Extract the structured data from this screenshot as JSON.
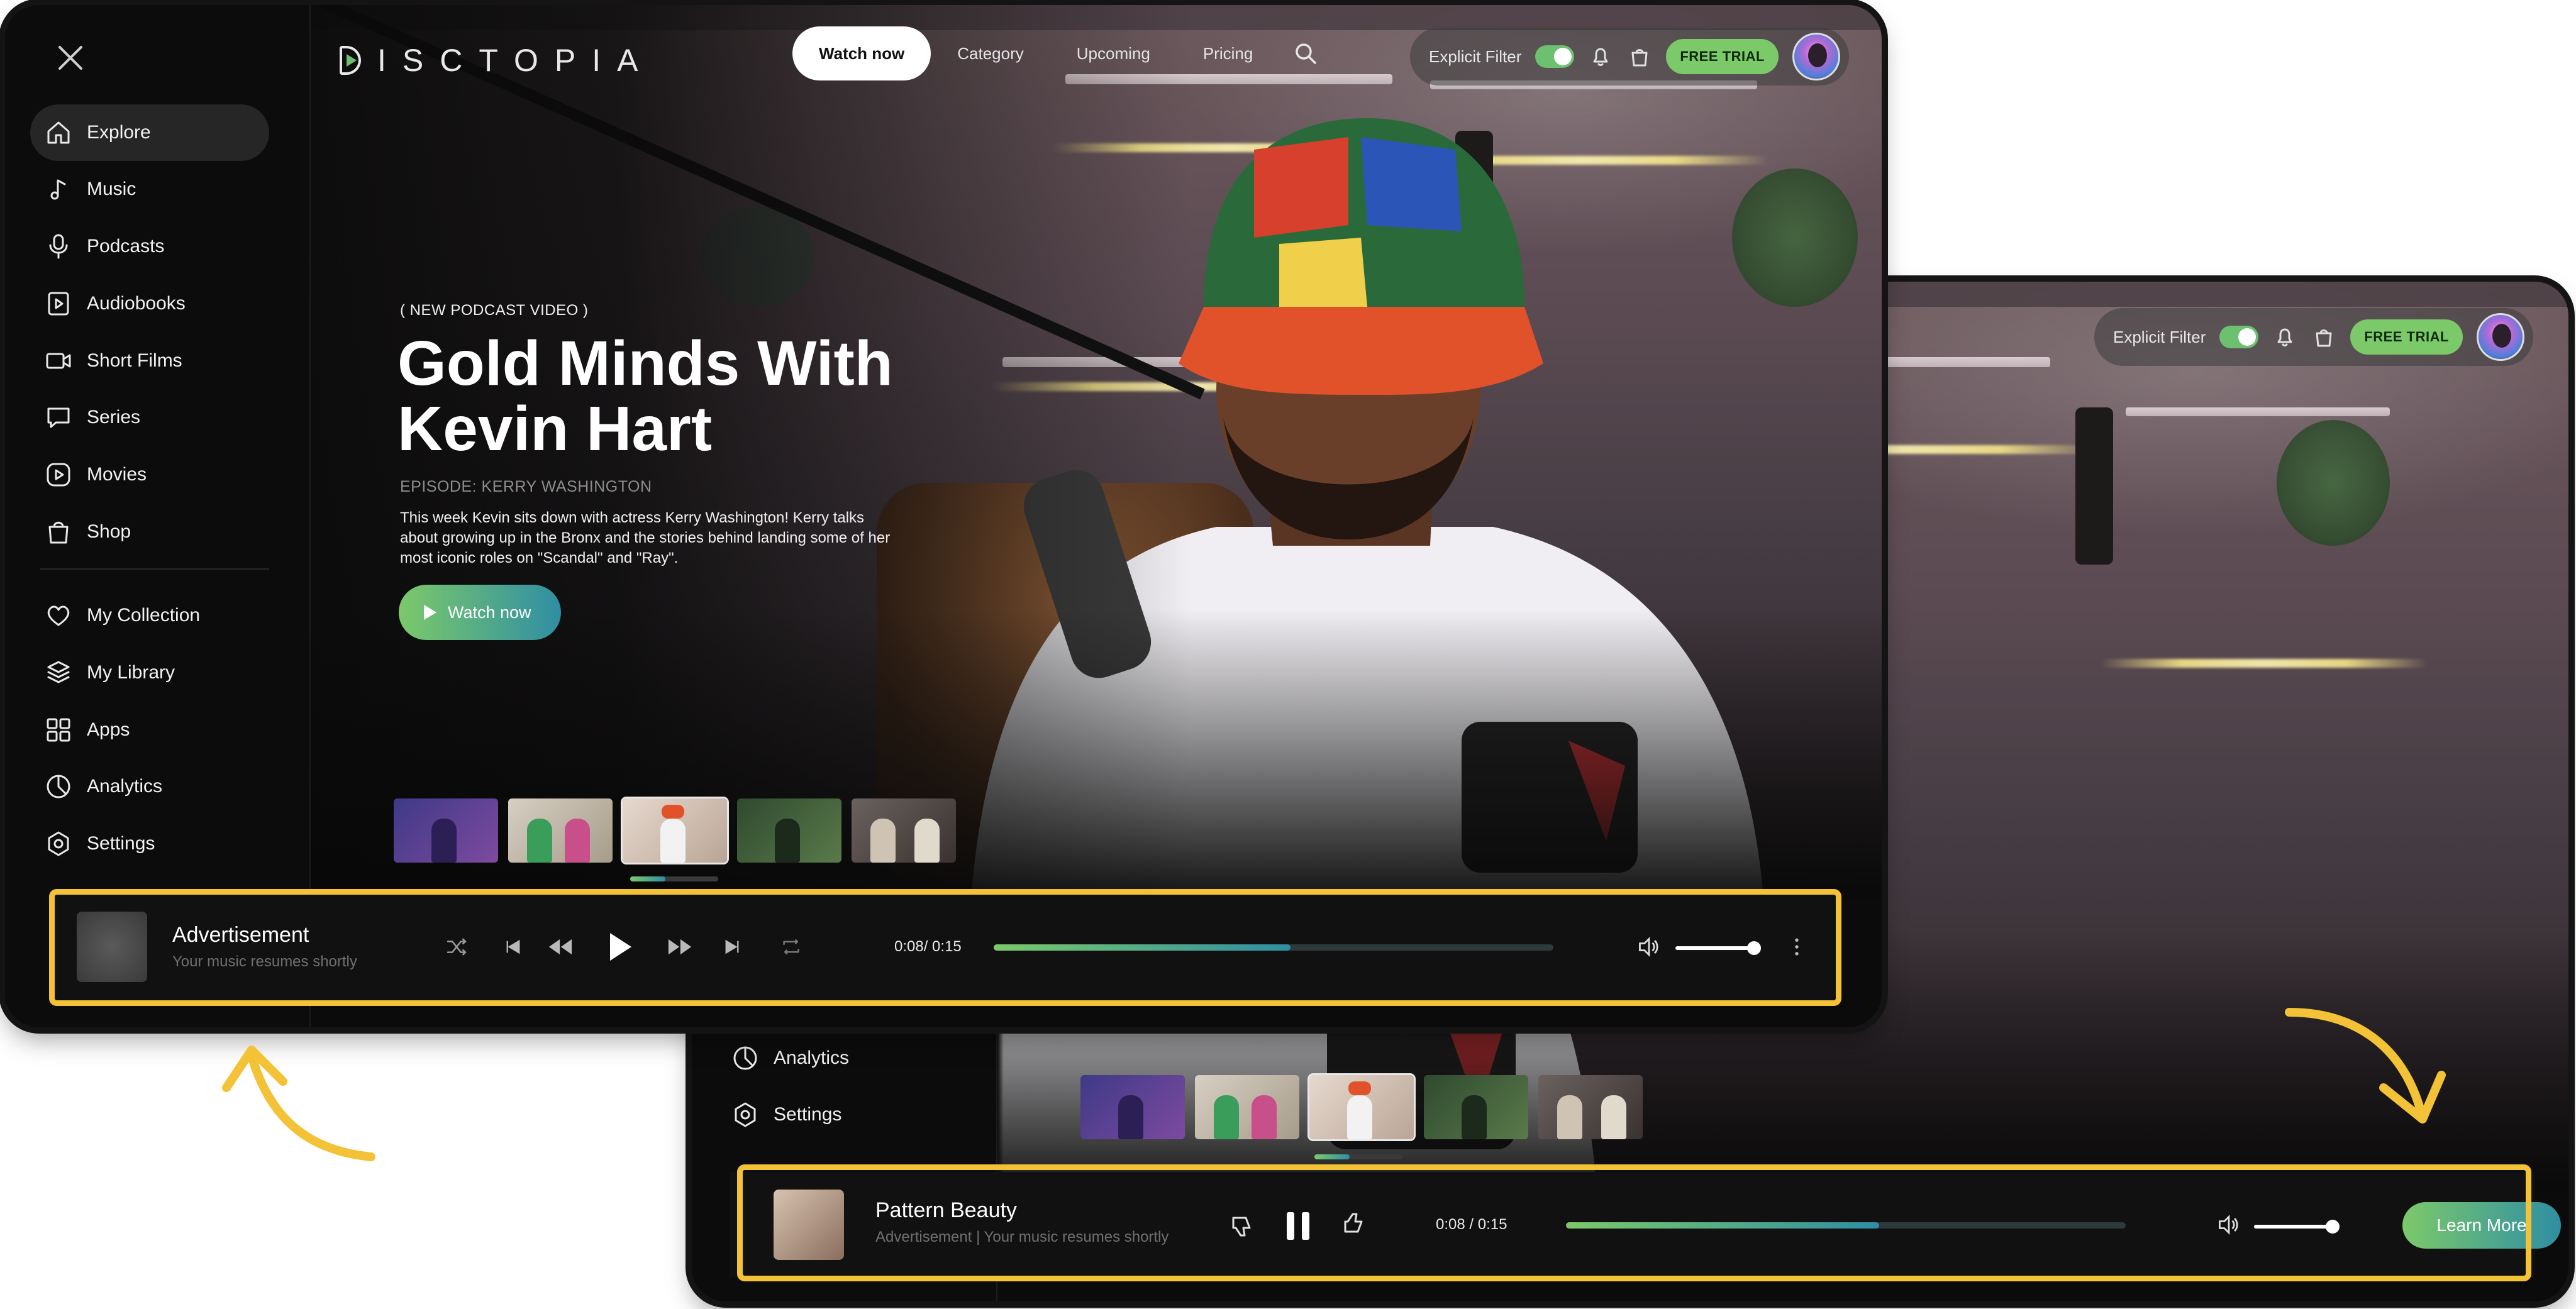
{
  "app": {
    "logo_text": "ISCTOPIA"
  },
  "sidebar": {
    "items": [
      {
        "label": "Explore",
        "icon": "home-icon"
      },
      {
        "label": "Music",
        "icon": "music-note-icon"
      },
      {
        "label": "Podcasts",
        "icon": "microphone-icon"
      },
      {
        "label": "Audiobooks",
        "icon": "book-play-icon"
      },
      {
        "label": "Short Films",
        "icon": "video-camera-icon"
      },
      {
        "label": "Series",
        "icon": "chat-bubble-icon"
      },
      {
        "label": "Movies",
        "icon": "play-circle-icon"
      },
      {
        "label": "Shop",
        "icon": "shopping-bag-icon"
      }
    ],
    "library_items": [
      {
        "label": "My Collection",
        "icon": "heart-icon"
      },
      {
        "label": "My Library",
        "icon": "layers-icon"
      },
      {
        "label": "Apps",
        "icon": "apps-grid-icon"
      },
      {
        "label": "Analytics",
        "icon": "pie-chart-icon"
      },
      {
        "label": "Settings",
        "icon": "settings-icon"
      }
    ]
  },
  "topnav": {
    "tabs": [
      "Watch now",
      "Category",
      "Upcoming",
      "Pricing"
    ],
    "active_tab": "Watch now",
    "cut_tab": "ricing"
  },
  "header_right": {
    "explicit_filter_label": "Explicit Filter",
    "explicit_filter_on": true,
    "free_trial_label": "FREE TRIAL"
  },
  "hero": {
    "tag": "( NEW PODCAST VIDEO )",
    "title_line1": "Gold Minds With",
    "title_line2": "Kevin Hart",
    "episode": "EPISODE: KERRY WASHINGTON",
    "description": "This week Kevin sits down with actress Kerry Washington! Kerry talks about growing up in the Bronx and the stories behind landing some of her most iconic roles on \"Scandal\" and \"Ray\".",
    "cta": "Watch now"
  },
  "player_a": {
    "title": "Advertisement",
    "subtitle": "Your music resumes shortly",
    "time": "0:08/ 0:15",
    "progress": 0.53,
    "volume": 1.0
  },
  "player_b": {
    "title": "Pattern Beauty",
    "subtitle": "Advertisement | Your music resumes shortly",
    "time": "0:08 / 0:15",
    "progress": 0.56,
    "volume": 1.0,
    "cta": "Learn More"
  },
  "screen_b_sidebar": {
    "items": [
      {
        "label": "Analytics",
        "icon": "pie-chart-icon"
      },
      {
        "label": "Settings",
        "icon": "settings-icon"
      }
    ]
  },
  "colors": {
    "accent_green": "#7cc96a",
    "accent_teal": "#2f8ea3",
    "highlight_yellow": "#f4c237",
    "background": "#0b0b0b"
  }
}
